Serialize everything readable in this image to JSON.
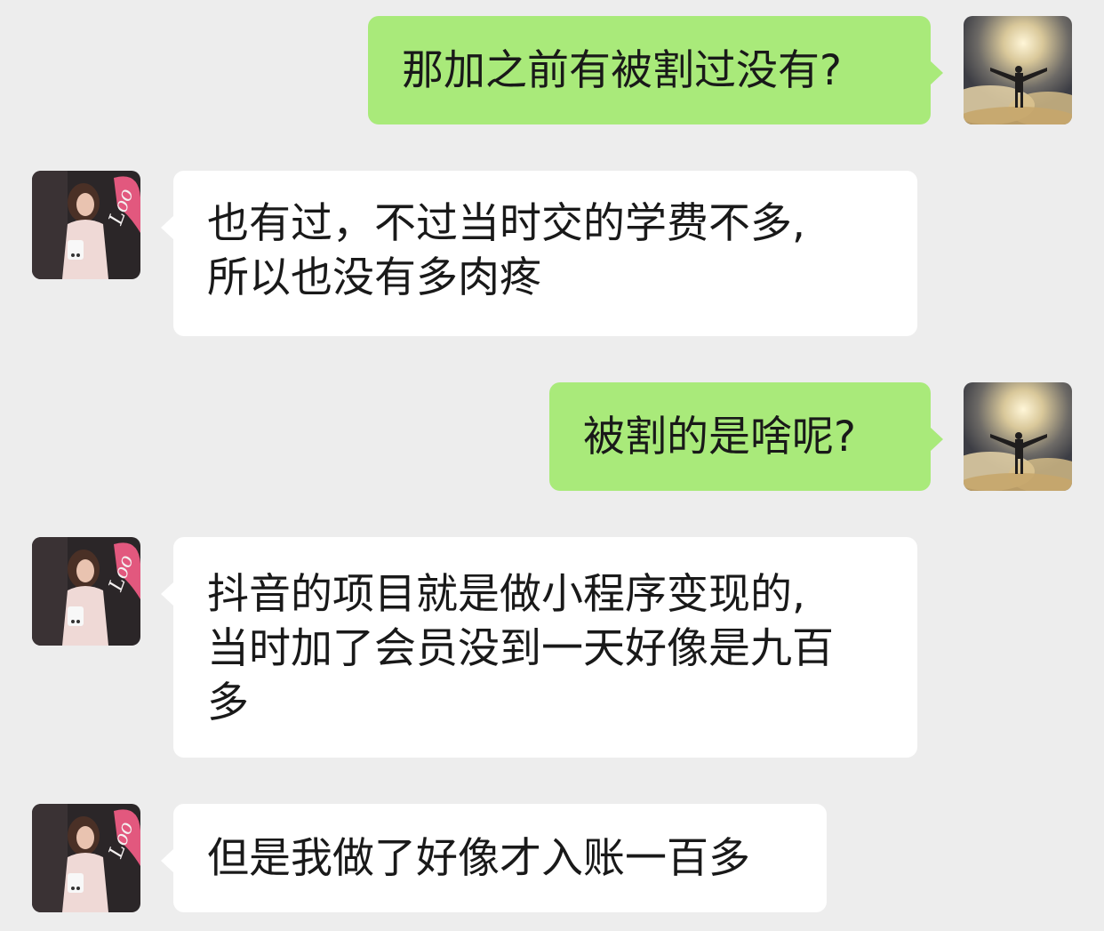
{
  "chat": {
    "messages": [
      {
        "side": "sent",
        "avatar": "self-avatar",
        "lines": [
          "那加之前有被割过没有?"
        ]
      },
      {
        "side": "recv",
        "avatar": "contact-avatar",
        "lines": [
          "也有过，不过当时交的学费不多,",
          "所以也没有多肉疼"
        ]
      },
      {
        "side": "sent",
        "avatar": "self-avatar",
        "lines": [
          "被割的是啥呢?"
        ]
      },
      {
        "side": "recv",
        "avatar": "contact-avatar",
        "lines": [
          "抖音的项目就是做小程序变现的,",
          "当时加了会员没到一天好像是九百",
          "多"
        ]
      },
      {
        "side": "recv",
        "avatar": "contact-avatar",
        "lines": [
          "但是我做了好像才入账一百多"
        ]
      }
    ]
  },
  "colors": {
    "background": "#ededed",
    "sent_bubble": "#a9ea7a",
    "received_bubble": "#ffffff",
    "text": "#191919"
  }
}
